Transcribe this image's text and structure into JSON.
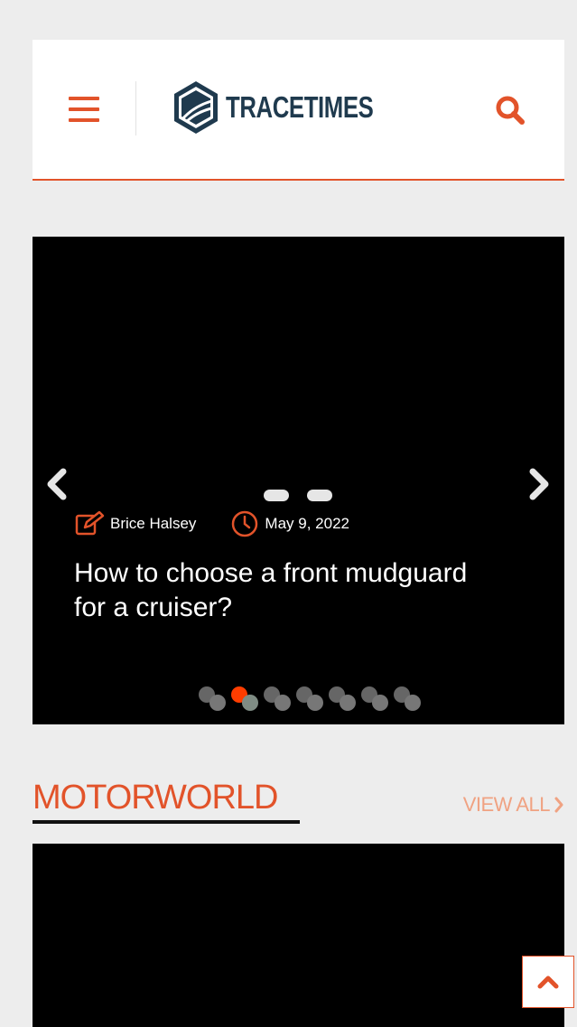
{
  "header": {
    "logo_text": "TRACETIMES",
    "accent_color": "#e2532a",
    "menu_icon": "hamburger-menu-icon",
    "search_icon": "search-icon"
  },
  "slider": {
    "author": "Brice Halsey",
    "date": "May 9, 2022",
    "title": "How to choose a front mudguard for a cruiser?",
    "slide_count": 7,
    "active_slide_index": 1
  },
  "section": {
    "title": "MOTORWORLD",
    "view_all": "VIEW ALL"
  }
}
